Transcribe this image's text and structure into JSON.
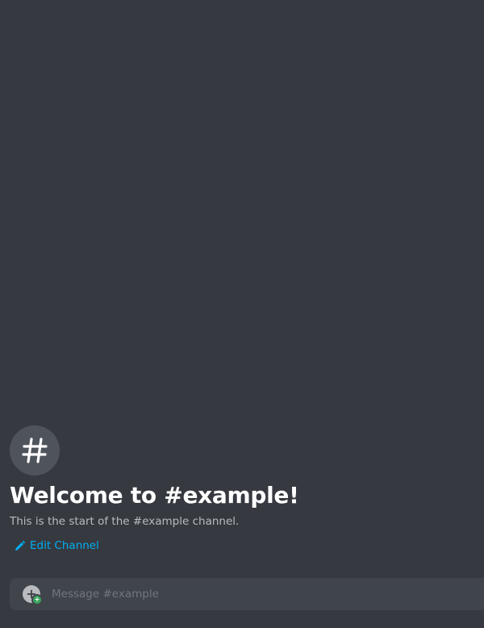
{
  "channel": {
    "name": "#example",
    "icon": "hashtag-icon"
  },
  "welcome": {
    "title": "Welcome to #example!",
    "subtitle": "This is the start of the #example channel.",
    "edit_label": "Edit Channel",
    "edit_icon": "pencil-icon"
  },
  "composer": {
    "placeholder": "Message #example",
    "value": "",
    "attach_icon": "plus-circle-icon"
  },
  "colors": {
    "background": "#36393f",
    "icon_circle": "#4f545c",
    "title": "#ffffff",
    "subtitle": "#b9bbbe",
    "link": "#00aff4",
    "composer_bg": "#40444b",
    "placeholder": "#72767d",
    "badge_green": "#3ba55d"
  }
}
